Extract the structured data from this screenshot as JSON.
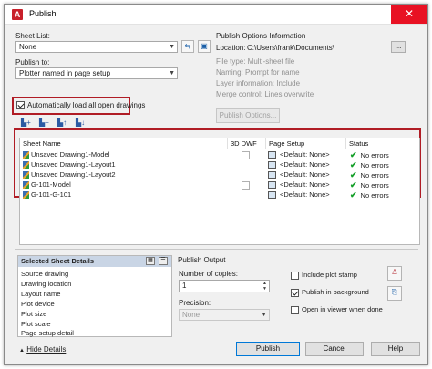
{
  "window": {
    "title": "Publish",
    "app_icon": "A",
    "close_glyph": "✕"
  },
  "sheet_list": {
    "label": "Sheet List:",
    "value": "None"
  },
  "publish_to": {
    "label": "Publish to:",
    "value": "Plotter named in page setup"
  },
  "auto_load": {
    "label": "Automatically load all open drawings",
    "checked": true
  },
  "publish_options": {
    "heading": "Publish Options Information",
    "location_label": "Location:",
    "location_value": "C:\\Users\\frank\\Documents\\",
    "browse_label": "...",
    "file_type": "File type: Multi-sheet file",
    "naming": "Naming: Prompt for name",
    "layer_info": "Layer information: Include",
    "merge_control": "Merge control: Lines overwrite",
    "button": "Publish Options..."
  },
  "table": {
    "headers": [
      "Sheet Name",
      "3D DWF",
      "Page Setup",
      "Status"
    ],
    "rows": [
      {
        "name": "Unsaved Drawing1-Model",
        "has_3d": true,
        "page_setup": "<Default: None>",
        "status": "No errors"
      },
      {
        "name": "Unsaved Drawing1-Layout1",
        "has_3d": false,
        "page_setup": "<Default: None>",
        "status": "No errors"
      },
      {
        "name": "Unsaved Drawing1-Layout2",
        "has_3d": false,
        "page_setup": "<Default: None>",
        "status": "No errors"
      },
      {
        "name": "G-101-Model",
        "has_3d": true,
        "page_setup": "<Default: None>",
        "status": "No errors"
      },
      {
        "name": "G-101-G-101",
        "has_3d": false,
        "page_setup": "<Default: None>",
        "status": "No errors"
      }
    ]
  },
  "selected_details": {
    "heading": "Selected Sheet Details",
    "items": [
      "Source drawing",
      "Drawing location",
      "Layout name",
      "Plot device",
      "Plot size",
      "Plot scale",
      "Page setup detail"
    ]
  },
  "publish_output": {
    "heading": "Publish Output",
    "copies_label": "Number of copies:",
    "copies_value": "1",
    "precision_label": "Precision:",
    "precision_value": "None",
    "include_plot_stamp": "Include plot stamp",
    "publish_background": "Publish in background",
    "open_viewer": "Open in viewer when done"
  },
  "footer": {
    "hide_details": "Hide Details",
    "publish": "Publish",
    "cancel": "Cancel",
    "help": "Help"
  },
  "colors": {
    "highlight_red": "#b01c25",
    "accent_blue": "#0078d7",
    "status_green": "#16a02a"
  }
}
